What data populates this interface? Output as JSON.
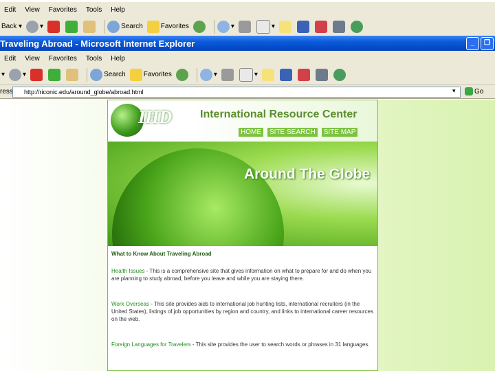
{
  "menubar": [
    "Edit",
    "View",
    "Favorites",
    "Tools",
    "Help"
  ],
  "toolbar": {
    "back": "Back",
    "search": "Search",
    "favorites": "Favorites"
  },
  "window": {
    "title": "Traveling Abroad - Microsoft Internet Explorer"
  },
  "address": {
    "label": "ress",
    "url": "http://riconic.edu/around_globe/abroad.html",
    "go": "Go"
  },
  "site": {
    "logo": "IHD",
    "title": "International Resource Center",
    "nav": [
      "HOME",
      "SITE SEARCH",
      "SITE MAP"
    ],
    "banner_title": "Around The Globe",
    "heading": "What to Know About Traveling Abroad",
    "items": [
      {
        "link": "Health Issues",
        "text": " - This is a comprehensive site that gives information on what to prepare for and do when you are planning to study abroad, before you leave and while you are staying there."
      },
      {
        "link": "Work Overseas",
        "text": " - This site provides aids to international job hunting lists, international recruiters (in the United States), listings of job opportunities by region and country, and links to international career resources on the web."
      },
      {
        "link": "Foreign Languages for Travelers",
        "text": " - This site provides the user to search words or phrases in 31 languages."
      }
    ]
  }
}
